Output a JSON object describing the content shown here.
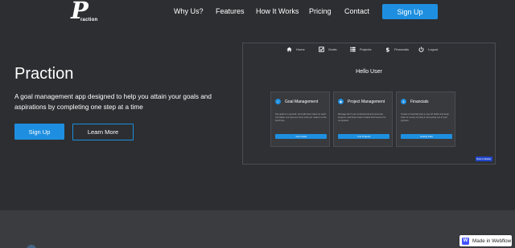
{
  "nav": {
    "logo_letter": "P",
    "logo_text": "raction",
    "links": [
      "Why Us?",
      "Features",
      "How It Works",
      "Pricing",
      "Contact"
    ],
    "signup_label": "Sign Up"
  },
  "hero": {
    "title": "Praction",
    "description": "A goal management app designed to help you attain your goals and aspirations by completing one step at a time",
    "primary_button": "Sign Up",
    "secondary_button": "Learn More"
  },
  "preview": {
    "nav": [
      {
        "icon": "home-icon",
        "label": "Home"
      },
      {
        "icon": "checkbox-icon",
        "label": "Goals"
      },
      {
        "icon": "list-icon",
        "label": "Projects"
      },
      {
        "icon": "dollar-icon",
        "label": "Financials"
      },
      {
        "icon": "logout-icon",
        "label": "Logout"
      }
    ],
    "greeting": "Hello User",
    "cards": [
      {
        "title": "Goal Management",
        "description": "Set goals for yourself, and add clear steps for each. Complete one step at a time until you make it to the finish line.",
        "button": "Your Goals"
      },
      {
        "title": "Project Management",
        "description": "Manage all of your professional and personal projects, and keep track of tasks that need to be completed.",
        "button": "Your Projects"
      },
      {
        "title": "Financials",
        "description": "Create a financial plan to pay off debts and keep track of money coming in and going out of your pockets.",
        "button": "Getting Start"
      }
    ],
    "badge": "Built on Bubble"
  },
  "webflow_badge": "Made in Webflow",
  "colors": {
    "background": "#2c2e31",
    "accent": "#1e8fe0",
    "lower_section": "#3a3c3f"
  }
}
